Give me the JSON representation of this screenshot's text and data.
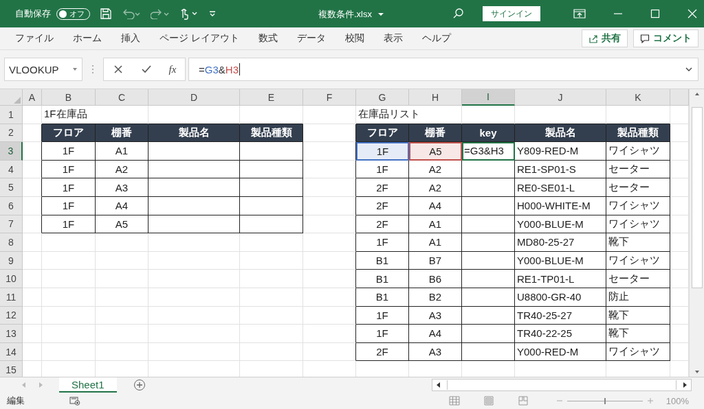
{
  "title_bar": {
    "autosave_label": "自動保存",
    "autosave_toggle": {
      "label": "オフ",
      "on": false
    },
    "file_name": "複数条件.xlsx",
    "sign_in": "サインイン"
  },
  "menu": {
    "tabs": [
      {
        "label": "ファイル",
        "selected": false
      },
      {
        "label": "ホーム",
        "selected": false
      },
      {
        "label": "挿入",
        "selected": false
      },
      {
        "label": "ページ レイアウト",
        "selected": false
      },
      {
        "label": "数式",
        "selected": false
      },
      {
        "label": "データ",
        "selected": false
      },
      {
        "label": "校閲",
        "selected": false
      },
      {
        "label": "表示",
        "selected": false
      },
      {
        "label": "ヘルプ",
        "selected": false
      }
    ],
    "share": "共有",
    "comment": "コメント"
  },
  "formula_bar": {
    "name_box": "VLOOKUP",
    "fx": "fx",
    "tokens": [
      {
        "text": "=",
        "kind": "plain"
      },
      {
        "text": "G3",
        "kind": "ref",
        "color": "#4472c4"
      },
      {
        "text": "&",
        "kind": "plain"
      },
      {
        "text": "H3",
        "kind": "ref",
        "color": "#c0504d"
      }
    ]
  },
  "columns": [
    {
      "label": "A",
      "selected": false
    },
    {
      "label": "B",
      "selected": false
    },
    {
      "label": "C",
      "selected": false
    },
    {
      "label": "D",
      "selected": false
    },
    {
      "label": "E",
      "selected": false
    },
    {
      "label": "F",
      "selected": false
    },
    {
      "label": "G",
      "selected": false
    },
    {
      "label": "H",
      "selected": false
    },
    {
      "label": "I",
      "selected": true
    },
    {
      "label": "J",
      "selected": false
    },
    {
      "label": "K",
      "selected": false
    }
  ],
  "row_headers": [
    {
      "label": "1",
      "selected": false
    },
    {
      "label": "2",
      "selected": false
    },
    {
      "label": "3",
      "selected": true
    },
    {
      "label": "4",
      "selected": false
    },
    {
      "label": "5",
      "selected": false
    },
    {
      "label": "6",
      "selected": false
    },
    {
      "label": "7",
      "selected": false
    },
    {
      "label": "8",
      "selected": false
    },
    {
      "label": "9",
      "selected": false
    },
    {
      "label": "10",
      "selected": false
    },
    {
      "label": "11",
      "selected": false
    },
    {
      "label": "12",
      "selected": false
    },
    {
      "label": "13",
      "selected": false
    },
    {
      "label": "14",
      "selected": false
    },
    {
      "label": "15",
      "selected": false
    }
  ],
  "left_table": {
    "title": "1F在庫品",
    "columns": [
      "フロア",
      "棚番",
      "製品名",
      "製品種類"
    ],
    "rows": [
      {
        "floor": "1F",
        "shelf": "A1"
      },
      {
        "floor": "1F",
        "shelf": "A2"
      },
      {
        "floor": "1F",
        "shelf": "A3"
      },
      {
        "floor": "1F",
        "shelf": "A4"
      },
      {
        "floor": "1F",
        "shelf": "A5"
      }
    ]
  },
  "inventory_list": {
    "title": "在庫品リスト",
    "columns": [
      "フロア",
      "棚番",
      "key",
      "製品名",
      "製品種類"
    ],
    "rows": [
      {
        "floor": "1F",
        "shelf": "A5",
        "key": "=G3&H3",
        "product": "Y809-RED-M",
        "type": "ワイシャツ",
        "editing": true,
        "highlights": [
          {
            "kind": "floor",
            "color": "#4472c4"
          },
          {
            "kind": "shelf",
            "color": "#c0504d"
          }
        ]
      },
      {
        "floor": "1F",
        "shelf": "A2",
        "product": "RE1-SP01-S",
        "type": "セーター",
        "editing": false
      },
      {
        "floor": "2F",
        "shelf": "A2",
        "product": "RE0-SE01-L",
        "type": "セーター",
        "editing": false
      },
      {
        "floor": "2F",
        "shelf": "A4",
        "product": "H000-WHITE-M",
        "type": "ワイシャツ",
        "editing": false
      },
      {
        "floor": "2F",
        "shelf": "A1",
        "product": "Y000-BLUE-M",
        "type": "ワイシャツ",
        "editing": false
      },
      {
        "floor": "1F",
        "shelf": "A1",
        "product": "MD80-25-27",
        "type": "靴下",
        "editing": false
      },
      {
        "floor": "B1",
        "shelf": "B7",
        "product": "Y000-BLUE-M",
        "type": "ワイシャツ",
        "editing": false
      },
      {
        "floor": "B1",
        "shelf": "B6",
        "product": "RE1-TP01-L",
        "type": "セーター",
        "editing": false
      },
      {
        "floor": "B1",
        "shelf": "B2",
        "product": "U8800-GR-40",
        "type": "防止",
        "editing": false
      },
      {
        "floor": "1F",
        "shelf": "A3",
        "product": "TR40-25-27",
        "type": "靴下",
        "editing": false
      },
      {
        "floor": "1F",
        "shelf": "A4",
        "product": "TR40-22-25",
        "type": "靴下",
        "editing": false
      },
      {
        "floor": "2F",
        "shelf": "A3",
        "product": "Y000-RED-M",
        "type": "ワイシャツ",
        "editing": false
      }
    ]
  },
  "sheet_tabs": [
    {
      "label": "Sheet1",
      "selected": true
    }
  ],
  "status_bar": {
    "mode": "編集",
    "zoom": {
      "level": 0.5,
      "label": "100%"
    }
  }
}
